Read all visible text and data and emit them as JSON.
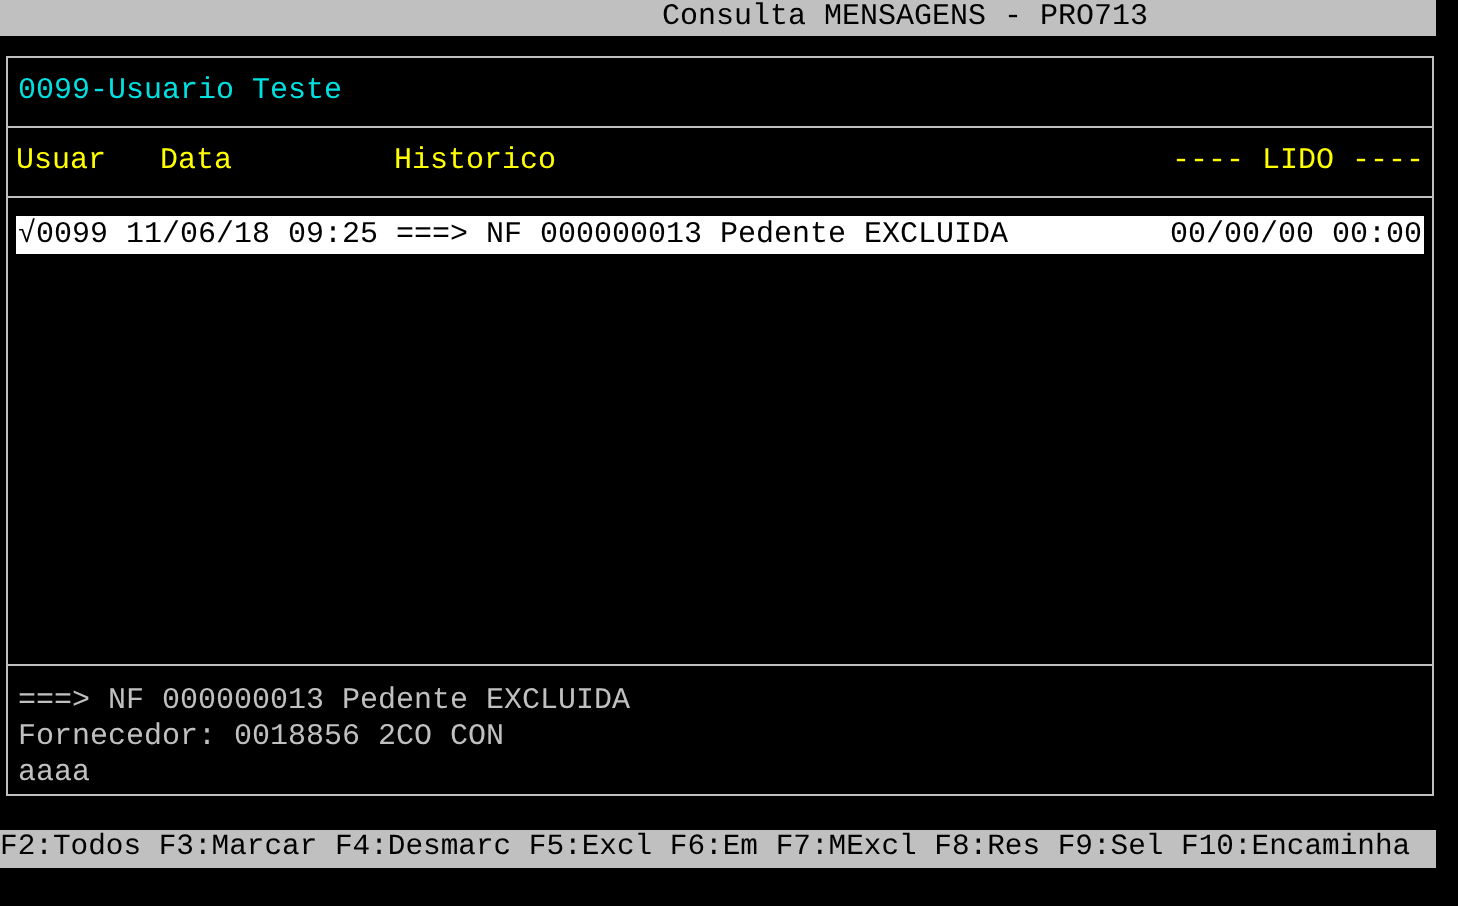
{
  "window": {
    "title": "Consulta MENSAGENS - PRO713"
  },
  "user": "0099-Usuario Teste",
  "table": {
    "columns": [
      "Usuar",
      "Data",
      "Historico",
      "---- LIDO ----"
    ],
    "rows": [
      {
        "user": "√0099",
        "date": "11/06/18 09:25",
        "history": "===> NF 000000013 Pedente EXCLUIDA",
        "read": "00/00/00 00:00",
        "selected": true
      }
    ]
  },
  "detail": [
    "===> NF 000000013 Pedente EXCLUIDA",
    "Fornecedor: 0018856 2CO CON",
    "aaaa"
  ],
  "function_keys": "F2:Todos F3:Marcar F4:Desmarc F5:Excl F6:Em F7:MExcl F8:Res F9:Sel F10:Encaminha"
}
